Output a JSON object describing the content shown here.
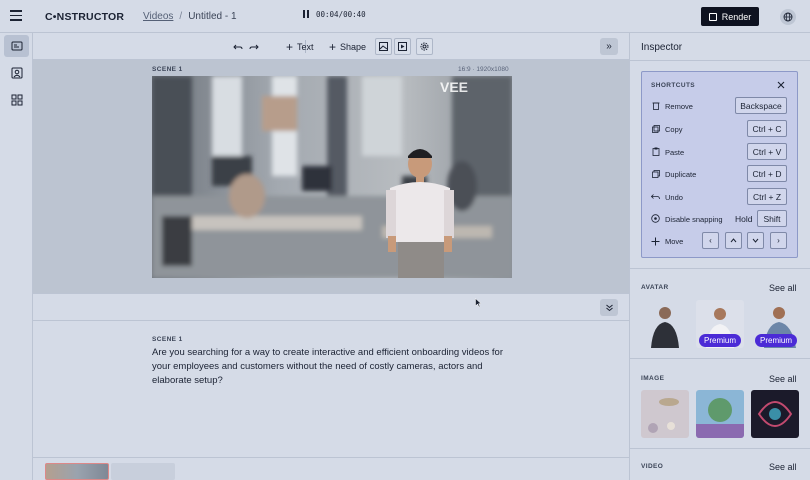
{
  "app": {
    "logo": "C•NSTRUCTOR"
  },
  "breadcrumb": {
    "parent": "Videos",
    "separator": "/",
    "current": "Untitled - 1"
  },
  "header": {
    "render_label": "Render"
  },
  "toolbar": {
    "text_label": "Text",
    "shape_label": "Shape"
  },
  "stage": {
    "scene_label": "SCENE 1",
    "aspect": "16:9 · 1920x1080",
    "watermark": "VEE"
  },
  "playback": {
    "time": "00:04/00:40"
  },
  "script": {
    "scene_label": "SCENE 1",
    "text": "Are you searching for a way to create interactive and efficient onboarding videos for your employees and customers without the need of costly cameras, actors and elaborate setup?"
  },
  "inspector": {
    "title": "Inspector",
    "shortcuts": {
      "title": "SHORTCUTS",
      "rows": [
        {
          "label": "Remove",
          "key": "Backspace",
          "icon": "trash-icon"
        },
        {
          "label": "Copy",
          "key": "Ctrl + C",
          "icon": "copy-icon"
        },
        {
          "label": "Paste",
          "key": "Ctrl + V",
          "icon": "clipboard-icon"
        },
        {
          "label": "Duplicate",
          "key": "Ctrl + D",
          "icon": "duplicate-icon"
        },
        {
          "label": "Undo",
          "key": "Ctrl + Z",
          "icon": "undo-icon"
        },
        {
          "label": "Disable snapping",
          "hold": "Hold",
          "key": "Shift",
          "icon": "snap-icon"
        },
        {
          "label": "Move",
          "icon": "move-icon"
        }
      ]
    },
    "avatar": {
      "label": "AVATAR",
      "see_all": "See all",
      "premium": "Premium"
    },
    "image": {
      "label": "IMAGE",
      "see_all": "See all"
    },
    "video": {
      "label": "VIDEO",
      "see_all": "See all"
    }
  },
  "colors": {
    "accent": "#4b2bd6",
    "render_button": "#0e1220",
    "shortcut_panel": "#c6cce9"
  }
}
